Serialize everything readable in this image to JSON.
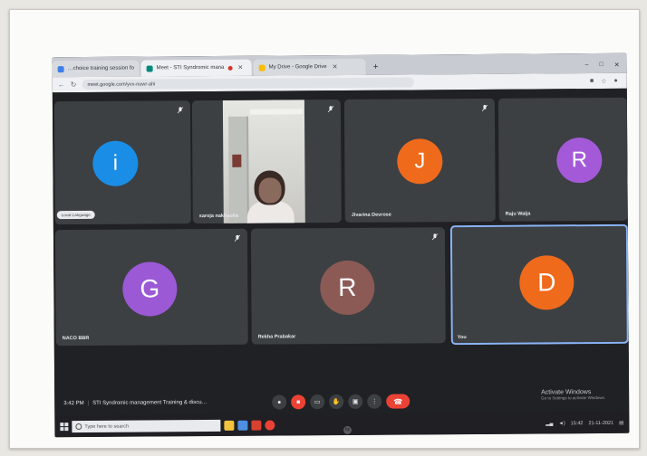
{
  "browser": {
    "tabs": [
      {
        "label": "…choice training session fo",
        "favicon_color": "#3f7ee8",
        "active": false
      },
      {
        "label": "Meet - STI Syndromic mana",
        "favicon_color": "#00897b",
        "active": true,
        "recording": true
      },
      {
        "label": "My Drive - Google Drive",
        "favicon_color": "#fbbc04",
        "active": false
      }
    ],
    "new_tab": "+",
    "url": "meet.google.com/yvx-nuwr-ahi",
    "window_controls": [
      "–",
      "□",
      "✕"
    ]
  },
  "participants": [
    {
      "name": "",
      "initial": "i",
      "color": "#1a8ee6",
      "chip": "Local Language"
    },
    {
      "name": "saroja nakhaolia",
      "initial": "",
      "video": true
    },
    {
      "name": "Jivarina Devrose",
      "initial": "J",
      "color": "#f06a1c"
    },
    {
      "name": "Raju Walja",
      "initial": "R",
      "color": "#a45ad8"
    },
    {
      "name": "NACO BBR",
      "initial": "G",
      "color": "#9b59d6"
    },
    {
      "name": "Rekha Prabakar",
      "initial": "R",
      "color": "#8c5a55"
    },
    {
      "name": "You",
      "initial": "D",
      "color": "#f06a1c"
    }
  ],
  "meeting": {
    "time": "3:42 PM",
    "title": "STI Syndromic management Training & discu…",
    "control_icons": [
      "mic-off",
      "camera-off",
      "captions",
      "hand",
      "present",
      "more",
      "end-call"
    ]
  },
  "watermark": {
    "line1": "Activate Windows",
    "line2": "Go to Settings to activate Windows."
  },
  "taskbar": {
    "search_placeholder": "Type here to search",
    "clock": "15:42",
    "date": "21-11-2021"
  },
  "colors": {
    "meet_bg": "#202124",
    "tile_bg": "#3c4043",
    "active_border": "#8ab4f8",
    "end_call": "#ea4335"
  }
}
